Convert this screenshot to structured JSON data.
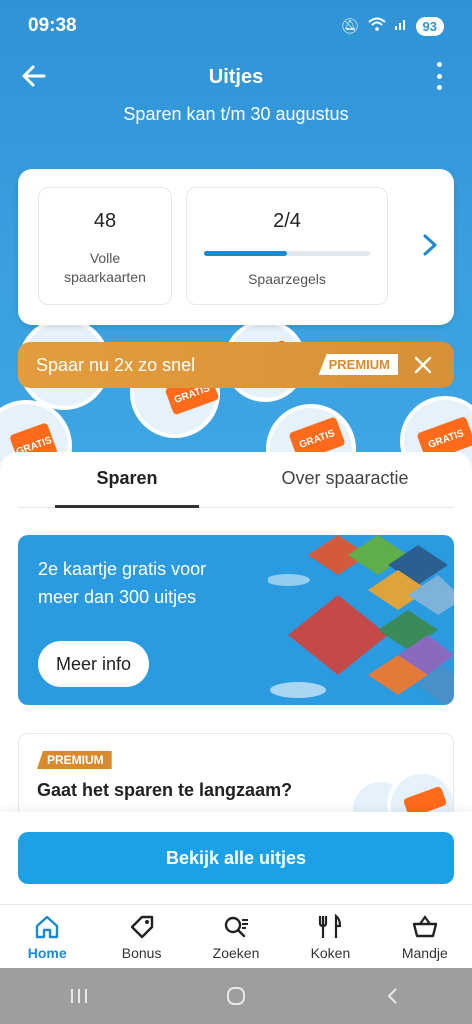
{
  "status": {
    "time": "09:38",
    "battery": "93"
  },
  "header": {
    "title": "Uitjes",
    "subtitle": "Sparen kan t/m 30 augustus"
  },
  "stats": {
    "full_cards_value": "48",
    "full_cards_label_line1": "Volle",
    "full_cards_label_line2": "spaarkaarten",
    "stamps_value": "2/4",
    "stamps_progress": 0.5,
    "stamps_label": "Spaarzegels"
  },
  "premium_banner": {
    "text": "Spaar nu 2x zo snel",
    "tag": "PREMIUM"
  },
  "tabs": [
    {
      "label": "Sparen"
    },
    {
      "label": "Over spaaractie"
    }
  ],
  "promo": {
    "line1": "2e kaartje gratis voor",
    "line2": "meer dan 300 uitjes",
    "button": "Meer info"
  },
  "premium_card": {
    "tag": "PREMIUM",
    "heading": "Gaat het sparen te langzaam?"
  },
  "cta": {
    "label": "Bekijk alle uitjes"
  },
  "bottom_nav": [
    {
      "label": "Home"
    },
    {
      "label": "Bonus"
    },
    {
      "label": "Zoeken"
    },
    {
      "label": "Koken"
    },
    {
      "label": "Mandje"
    }
  ],
  "colors": {
    "brand_blue": "#2f93d6",
    "accent_blue": "#1da1e6",
    "premium_orange": "#d98a2c",
    "stamp_orange": "#ff6b1a"
  }
}
